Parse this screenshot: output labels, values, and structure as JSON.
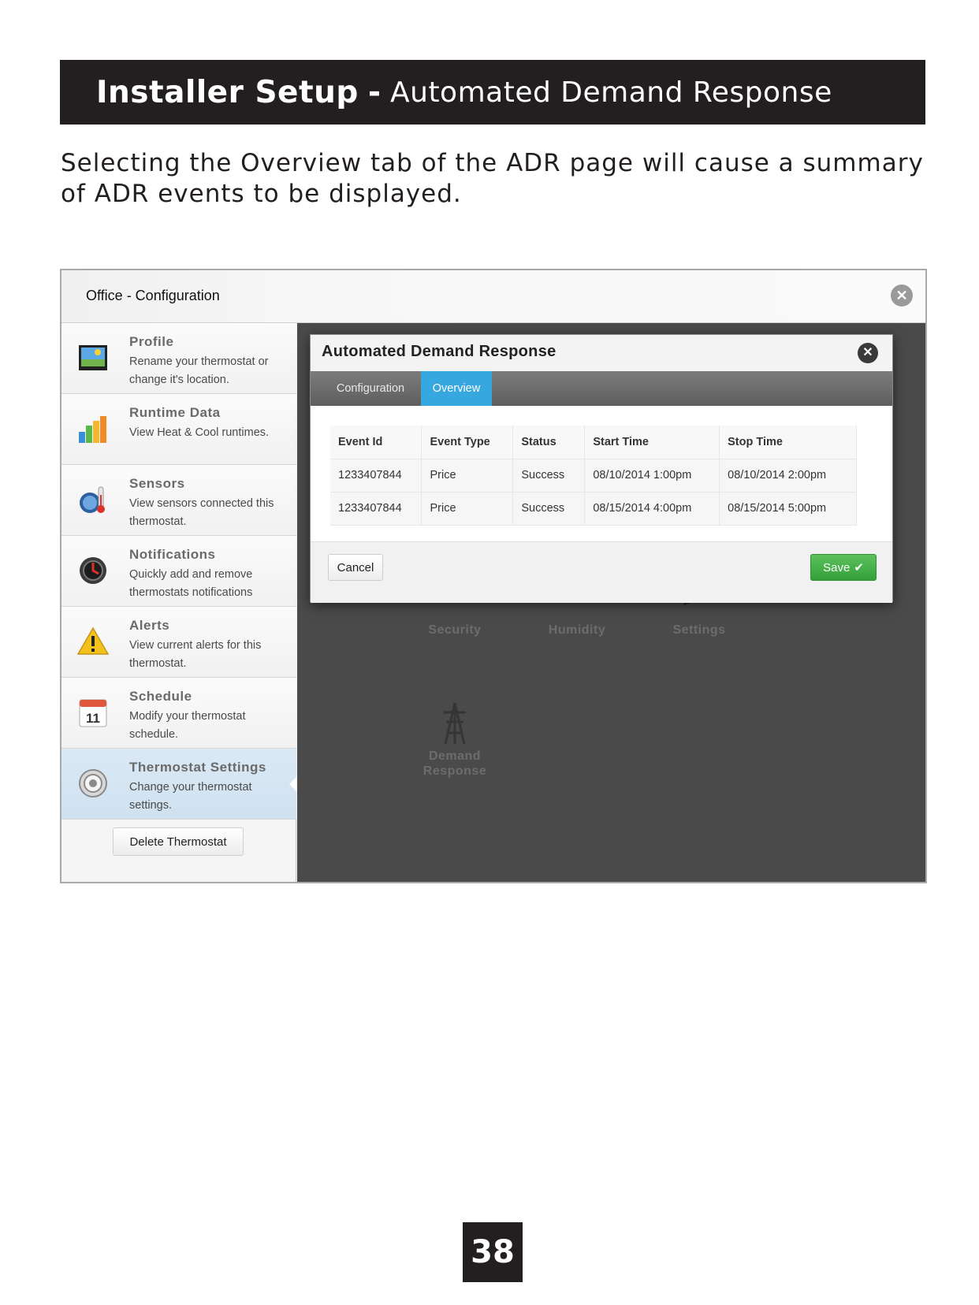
{
  "header": {
    "bold_title": "Installer Setup",
    "separator": "-",
    "subtitle": "Automated Demand Response"
  },
  "intro_text": "Selecting the Overview tab of the ADR page will cause a summary of ADR events to be displayed.",
  "page_number": "38",
  "screenshot": {
    "window_title": "Office - Configuration",
    "close_glyph": "✕",
    "sidebar": {
      "items": [
        {
          "title": "Profile",
          "desc": "Rename your thermostat or change it's location.",
          "icon": "profile-picture-icon"
        },
        {
          "title": "Runtime Data",
          "desc": "View Heat & Cool runtimes.",
          "icon": "bar-chart-icon"
        },
        {
          "title": "Sensors",
          "desc": "View sensors connected this thermostat.",
          "icon": "thermometer-icon"
        },
        {
          "title": "Notifications",
          "desc": "Quickly add and remove thermostats notifications",
          "icon": "alarm-icon"
        },
        {
          "title": "Alerts",
          "desc": "View current alerts for this thermostat.",
          "icon": "warning-icon"
        },
        {
          "title": "Schedule",
          "desc": "Modify your thermostat schedule.",
          "icon": "calendar-icon",
          "calendar_day": "11"
        },
        {
          "title": "Thermostat Settings",
          "desc": "Change your thermostat settings.",
          "icon": "settings-dial-icon",
          "selected": true
        }
      ],
      "delete_button": "Delete Thermostat"
    },
    "tiles": {
      "security": "Security",
      "humidity": "Humidity",
      "settings": "Settings",
      "demand_response": "Demand Response"
    },
    "modal": {
      "title": "Automated Demand Response",
      "close_glyph": "✕",
      "tabs": [
        {
          "label": "Configuration",
          "active": false
        },
        {
          "label": "Overview",
          "active": true
        }
      ],
      "table": {
        "columns": [
          "Event Id",
          "Event Type",
          "Status",
          "Start Time",
          "Stop Time"
        ],
        "rows": [
          [
            "1233407844",
            "Price",
            "Success",
            "08/10/2014 1:00pm",
            "08/10/2014 2:00pm"
          ],
          [
            "1233407844",
            "Price",
            "Success",
            "08/15/2014 4:00pm",
            "08/15/2014 5:00pm"
          ]
        ]
      },
      "cancel_label": "Cancel",
      "save_label": "Save",
      "save_check": "✔"
    },
    "colors": {
      "active_tab": "#37a7e0",
      "save_green": "#34a13a",
      "header_black": "#231f20"
    }
  }
}
